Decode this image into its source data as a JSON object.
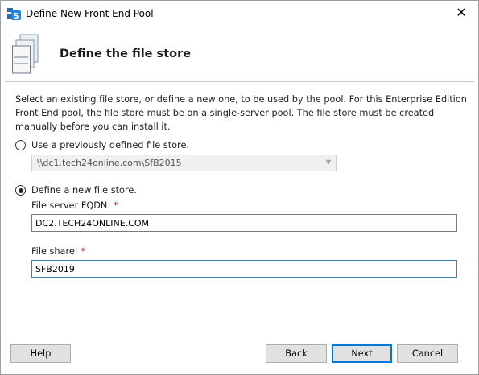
{
  "window": {
    "title": "Define New Front End Pool",
    "close_glyph": "✕"
  },
  "header": {
    "title": "Define the file store",
    "icon": "server-stack-icon"
  },
  "description": "Select an existing file store, or define a new one, to be used by the pool. For this Enterprise Edition Front End pool, the file store must be on a single-server pool. The file store must be created manually before you can install it.",
  "options": {
    "existing": {
      "label": "Use a previously defined file store.",
      "selected": false,
      "combo_value": "\\\\dc1.tech24online.com\\SfB2015"
    },
    "new_store": {
      "label": "Define a new file store.",
      "selected": true,
      "fqdn_label": "File server FQDN:",
      "fqdn_value": "DC2.TECH24ONLINE.COM",
      "share_label": "File share:",
      "share_value": "SFB2019",
      "required_mark": "*"
    }
  },
  "buttons": {
    "help": "Help",
    "back": "Back",
    "next": "Next",
    "cancel": "Cancel"
  },
  "colors": {
    "accent": "#0078d7",
    "required": "#d00000",
    "focus_border": "#3c7fb1"
  }
}
